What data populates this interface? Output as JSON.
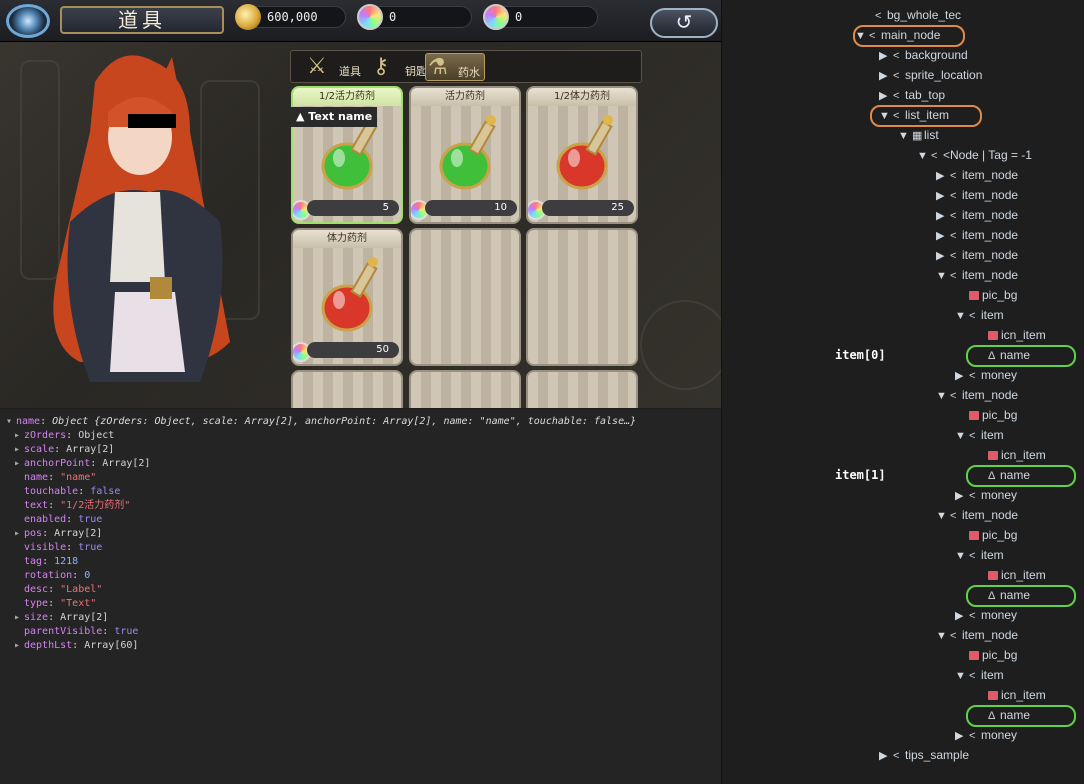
{
  "game": {
    "title": "道具",
    "currencies": [
      {
        "icon": "gold-coin-icon",
        "value": "600,000"
      },
      {
        "icon": "rainbow-gem-icon",
        "value": "0"
      },
      {
        "icon": "rainbow-gem-icon",
        "value": "0"
      }
    ],
    "back_icon": "↺",
    "tabs": [
      {
        "label": "道具",
        "icon": "sword-icon",
        "glyph": "⚔",
        "active": false
      },
      {
        "label": "钥匙",
        "icon": "key-icon",
        "glyph": "⚷",
        "active": false
      },
      {
        "label": "药水",
        "icon": "potion-icon",
        "glyph": "⚗",
        "active": true
      }
    ],
    "items": [
      {
        "name": "1/2活力药剂",
        "count": "5",
        "color": "#3fbf3a",
        "selected": true
      },
      {
        "name": "活力药剂",
        "count": "10",
        "color": "#3fbf3a",
        "selected": false
      },
      {
        "name": "1/2体力药剂",
        "count": "25",
        "color": "#d8372a",
        "selected": false
      },
      {
        "name": "体力药剂",
        "count": "50",
        "color": "#d8372a",
        "selected": false
      },
      {
        "name": "",
        "count": "",
        "color": "",
        "selected": false
      },
      {
        "name": "",
        "count": "",
        "color": "",
        "selected": false
      }
    ],
    "tooltip": "Text  name"
  },
  "console": {
    "header_key": "name",
    "header_rest": "Object {zOrders: Object, scale: Array[2], anchorPoint: Array[2], name: \"name\", touchable: false…}",
    "lines": [
      {
        "exp": true,
        "k": "zOrders",
        "v": "Object",
        "t": "kw"
      },
      {
        "exp": true,
        "k": "scale",
        "v": "Array[2]",
        "t": "kw"
      },
      {
        "exp": true,
        "k": "anchorPoint",
        "v": "Array[2]",
        "t": "kw"
      },
      {
        "exp": false,
        "k": "name",
        "v": "\"name\"",
        "t": "str"
      },
      {
        "exp": false,
        "k": "touchable",
        "v": "false",
        "t": "bool"
      },
      {
        "exp": false,
        "k": "text",
        "v": "\"1/2活力药剂\"",
        "t": "str"
      },
      {
        "exp": false,
        "k": "enabled",
        "v": "true",
        "t": "bool"
      },
      {
        "exp": true,
        "k": "pos",
        "v": "Array[2]",
        "t": "kw"
      },
      {
        "exp": false,
        "k": "visible",
        "v": "true",
        "t": "bool"
      },
      {
        "exp": false,
        "k": "tag",
        "v": "1218",
        "t": "num"
      },
      {
        "exp": false,
        "k": "rotation",
        "v": "0",
        "t": "num"
      },
      {
        "exp": false,
        "k": "desc",
        "v": "\"Label\"",
        "t": "str"
      },
      {
        "exp": false,
        "k": "type",
        "v": "\"Text\"",
        "t": "str"
      },
      {
        "exp": true,
        "k": "size",
        "v": "Array[2]",
        "t": "kw"
      },
      {
        "exp": false,
        "k": "parentVisible",
        "v": "true",
        "t": "bool"
      },
      {
        "exp": true,
        "k": "depthLst",
        "v": "Array[60]",
        "t": "kw"
      }
    ]
  },
  "tree": {
    "labels": [
      "item[0]",
      "item[1]"
    ],
    "nodes": [
      {
        "d": 0,
        "tri": "",
        "ic": "share",
        "label": "bg_whole_tec"
      },
      {
        "d": 1,
        "tri": "▼",
        "ic": "share",
        "label": "main_node"
      },
      {
        "d": 2,
        "tri": "▶",
        "ic": "share",
        "label": "background"
      },
      {
        "d": 2,
        "tri": "▶",
        "ic": "share",
        "label": "sprite_location"
      },
      {
        "d": 2,
        "tri": "▶",
        "ic": "share",
        "label": "tab_top"
      },
      {
        "d": 2,
        "tri": "▼",
        "ic": "share",
        "label": "list_item"
      },
      {
        "d": 3,
        "tri": "▼",
        "ic": "list",
        "label": "list"
      },
      {
        "d": 4,
        "tri": "▼",
        "ic": "share",
        "label": "<Node | Tag = -1"
      },
      {
        "d": 5,
        "tri": "▶",
        "ic": "share",
        "label": "item_node"
      },
      {
        "d": 5,
        "tri": "▶",
        "ic": "share",
        "label": "item_node"
      },
      {
        "d": 5,
        "tri": "▶",
        "ic": "share",
        "label": "item_node"
      },
      {
        "d": 5,
        "tri": "▶",
        "ic": "share",
        "label": "item_node"
      },
      {
        "d": 5,
        "tri": "▶",
        "ic": "share",
        "label": "item_node"
      },
      {
        "d": 5,
        "tri": "▼",
        "ic": "share",
        "label": "item_node"
      },
      {
        "d": 6,
        "tri": "",
        "ic": "img",
        "label": "pic_bg"
      },
      {
        "d": 6,
        "tri": "▼",
        "ic": "share",
        "label": "item"
      },
      {
        "d": 7,
        "tri": "",
        "ic": "img",
        "label": "icn_item"
      },
      {
        "d": 7,
        "tri": "",
        "ic": "text",
        "label": "name"
      },
      {
        "d": 6,
        "tri": "▶",
        "ic": "share",
        "label": "money"
      },
      {
        "d": 5,
        "tri": "▼",
        "ic": "share",
        "label": "item_node"
      },
      {
        "d": 6,
        "tri": "",
        "ic": "img",
        "label": "pic_bg"
      },
      {
        "d": 6,
        "tri": "▼",
        "ic": "share",
        "label": "item"
      },
      {
        "d": 7,
        "tri": "",
        "ic": "img",
        "label": "icn_item"
      },
      {
        "d": 7,
        "tri": "",
        "ic": "text",
        "label": "name"
      },
      {
        "d": 6,
        "tri": "▶",
        "ic": "share",
        "label": "money"
      },
      {
        "d": 5,
        "tri": "▼",
        "ic": "share",
        "label": "item_node"
      },
      {
        "d": 6,
        "tri": "",
        "ic": "img",
        "label": "pic_bg"
      },
      {
        "d": 6,
        "tri": "▼",
        "ic": "share",
        "label": "item"
      },
      {
        "d": 7,
        "tri": "",
        "ic": "img",
        "label": "icn_item"
      },
      {
        "d": 7,
        "tri": "",
        "ic": "text",
        "label": "name"
      },
      {
        "d": 6,
        "tri": "▶",
        "ic": "share",
        "label": "money"
      },
      {
        "d": 5,
        "tri": "▼",
        "ic": "share",
        "label": "item_node"
      },
      {
        "d": 6,
        "tri": "",
        "ic": "img",
        "label": "pic_bg"
      },
      {
        "d": 6,
        "tri": "▼",
        "ic": "share",
        "label": "item"
      },
      {
        "d": 7,
        "tri": "",
        "ic": "img",
        "label": "icn_item"
      },
      {
        "d": 7,
        "tri": "",
        "ic": "text",
        "label": "name"
      },
      {
        "d": 6,
        "tri": "▶",
        "ic": "share",
        "label": "money"
      },
      {
        "d": 2,
        "tri": "▶",
        "ic": "share",
        "label": "tips_sample"
      }
    ]
  }
}
